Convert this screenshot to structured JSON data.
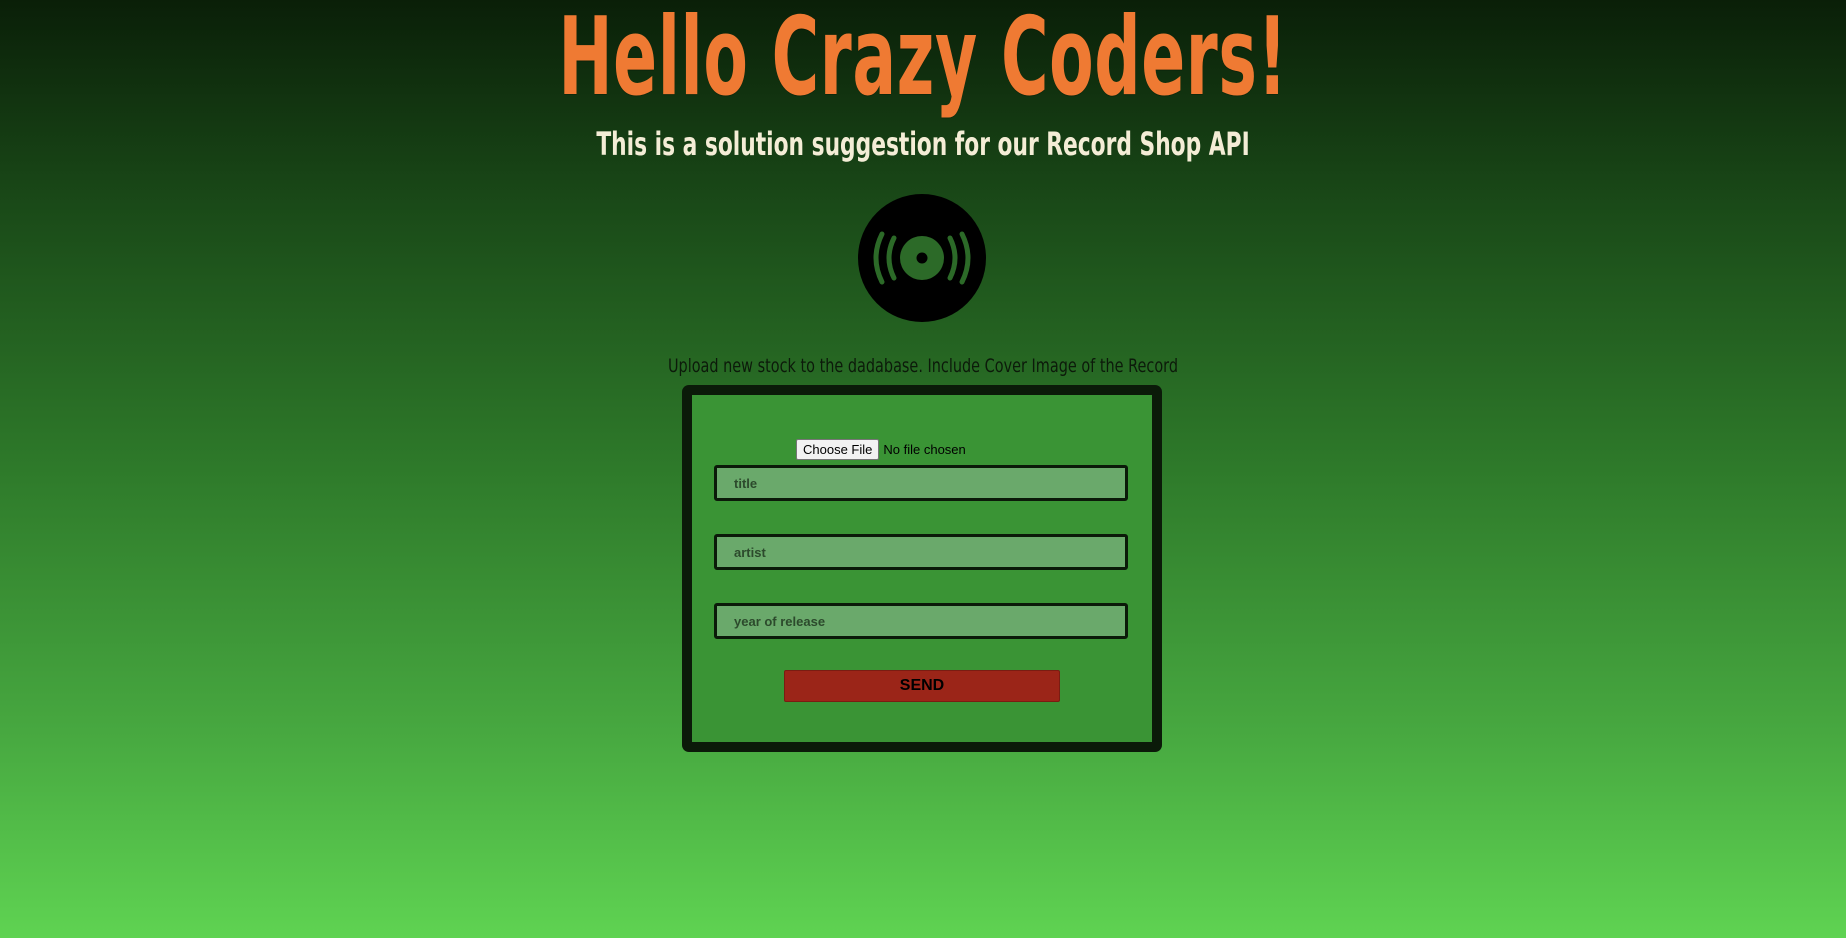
{
  "header": {
    "title": "Hello Crazy Coders!",
    "subtitle": "This is a solution suggestion for our Record Shop API"
  },
  "logo": {
    "icon": "vinyl-record-icon"
  },
  "upload": {
    "caption": "Upload new stock to the dadabase. Include Cover Image of the Record",
    "file_button_label": "Choose File",
    "file_status": "No file chosen",
    "fields": {
      "title_placeholder": "title",
      "artist_placeholder": "artist",
      "year_placeholder": "year of release"
    },
    "send_label": "SEND"
  },
  "colors": {
    "title": "#ef7a33",
    "subtitle": "#f4edd6",
    "frame": "#0b1a09",
    "panel": "#3a9435",
    "field_bg": "#6aa96b",
    "send_button": "#9b2518"
  }
}
